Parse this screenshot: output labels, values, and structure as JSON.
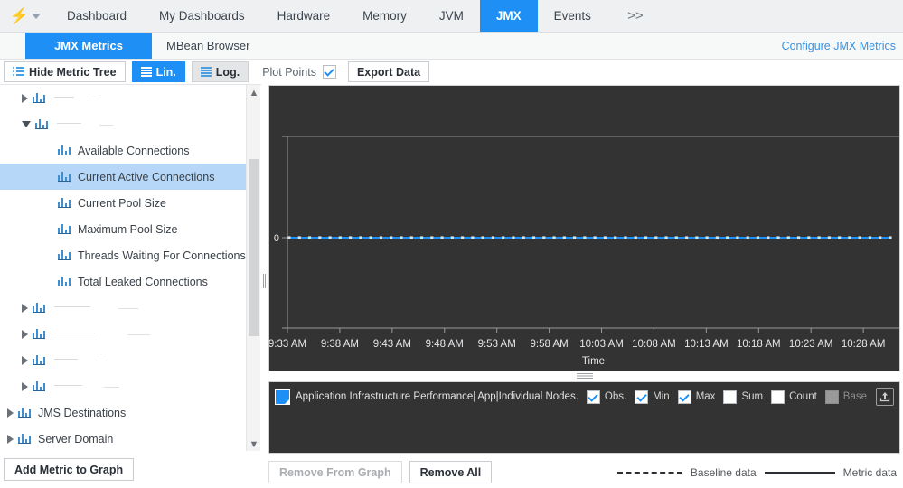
{
  "topnav": {
    "logo_icon": "bolt-icon",
    "caret_icon": "chevron-down-icon",
    "items": [
      {
        "label": "Dashboard",
        "active": false
      },
      {
        "label": "My Dashboards",
        "active": false
      },
      {
        "label": "Hardware",
        "active": false
      },
      {
        "label": "Memory",
        "active": false
      },
      {
        "label": "JVM",
        "active": false
      },
      {
        "label": "JMX",
        "active": true
      },
      {
        "label": "Events",
        "active": false
      }
    ],
    "more_label": ">>"
  },
  "subnav": {
    "tabs": [
      {
        "label": "JMX Metrics",
        "active": true
      },
      {
        "label": "MBean Browser",
        "active": false
      }
    ],
    "configure_link": "Configure JMX Metrics"
  },
  "toolbar": {
    "hide_tree_label": "Hide Metric Tree",
    "hide_tree_icon": "tree-list-icon",
    "lin_label": "Lin.",
    "lin_icon": "lines-icon",
    "log_label": "Log.",
    "log_icon": "lines-icon",
    "plot_points_label": "Plot Points",
    "plot_points_checked": true,
    "export_label": "Export Data"
  },
  "tree": {
    "items": [
      {
        "label": "",
        "redacted": true,
        "state": "collapsed",
        "depth": 1,
        "selected": false
      },
      {
        "label": "",
        "redacted": true,
        "state": "expanded",
        "depth": 1,
        "selected": false
      },
      {
        "label": "Available Connections",
        "redacted": false,
        "state": "leaf",
        "depth": 2,
        "selected": false
      },
      {
        "label": "Current Active Connections",
        "redacted": false,
        "state": "leaf",
        "depth": 2,
        "selected": true
      },
      {
        "label": "Current Pool Size",
        "redacted": false,
        "state": "leaf",
        "depth": 2,
        "selected": false
      },
      {
        "label": "Maximum Pool Size",
        "redacted": false,
        "state": "leaf",
        "depth": 2,
        "selected": false
      },
      {
        "label": "Threads Waiting For Connections",
        "redacted": false,
        "state": "leaf",
        "depth": 2,
        "selected": false
      },
      {
        "label": "Total Leaked Connections",
        "redacted": false,
        "state": "leaf",
        "depth": 2,
        "selected": false
      },
      {
        "label": "",
        "redacted": true,
        "state": "collapsed",
        "depth": 1,
        "selected": false
      },
      {
        "label": "",
        "redacted": true,
        "state": "collapsed",
        "depth": 1,
        "selected": false
      },
      {
        "label": "",
        "redacted": true,
        "state": "collapsed",
        "depth": 1,
        "selected": false
      },
      {
        "label": "",
        "redacted": true,
        "state": "collapsed",
        "depth": 1,
        "selected": false
      },
      {
        "label": "JMS Destinations",
        "redacted": false,
        "state": "collapsed",
        "depth": 0,
        "selected": false
      },
      {
        "label": "Server Domain",
        "redacted": false,
        "state": "collapsed",
        "depth": 0,
        "selected": false
      }
    ],
    "scroll_up_icon": "chevron-up-icon",
    "scroll_down_icon": "chevron-down-icon",
    "add_metric_label": "Add Metric to Graph"
  },
  "chart_data": {
    "type": "line",
    "title": "",
    "xlabel": "Time",
    "ylabel": "",
    "x": [
      "9:33 AM",
      "9:38 AM",
      "9:43 AM",
      "9:48 AM",
      "9:53 AM",
      "9:58 AM",
      "10:03 AM",
      "10:08 AM",
      "10:13 AM",
      "10:18 AM",
      "10:23 AM",
      "10:28 AM"
    ],
    "xtick_labels": [
      "9:33 AM",
      "9:38 AM",
      "9:43 AM",
      "9:48 AM",
      "9:53 AM",
      "9:58 AM",
      "10:03 AM",
      "10:08 AM",
      "10:13 AM",
      "10:18 AM",
      "10:23 AM",
      "10:28 AM"
    ],
    "ytick_labels": [
      "0"
    ],
    "ylim": [
      -1,
      1
    ],
    "grid": false,
    "legend_position": "below",
    "series": [
      {
        "name": "Application Infrastructure Performance|App|Individual Nodes...",
        "color": "#1e90f5",
        "marker": "square",
        "n_points": 60,
        "values": [
          0,
          0,
          0,
          0,
          0,
          0,
          0,
          0,
          0,
          0,
          0,
          0,
          0,
          0,
          0,
          0,
          0,
          0,
          0,
          0,
          0,
          0,
          0,
          0,
          0,
          0,
          0,
          0,
          0,
          0,
          0,
          0,
          0,
          0,
          0,
          0,
          0,
          0,
          0,
          0,
          0,
          0,
          0,
          0,
          0,
          0,
          0,
          0,
          0,
          0,
          0,
          0,
          0,
          0,
          0,
          0,
          0,
          0,
          0,
          0
        ]
      }
    ],
    "background": "#333333",
    "axis_color": "#9a9a9a"
  },
  "legend": {
    "series_name_prefix": "Application Infrastructure Performance|",
    "series_name_suffix": "App|Individual Nodes...",
    "swatch_color": "#1e90f5",
    "toggles": [
      {
        "label": "Obs.",
        "checked": true,
        "disabled": false
      },
      {
        "label": "Min",
        "checked": true,
        "disabled": false
      },
      {
        "label": "Max",
        "checked": true,
        "disabled": false
      },
      {
        "label": "Sum",
        "checked": false,
        "disabled": false
      },
      {
        "label": "Count",
        "checked": false,
        "disabled": false
      },
      {
        "label": "Base",
        "checked": false,
        "disabled": true
      }
    ],
    "upload_icon": "upload-icon"
  },
  "bottom": {
    "remove_from_graph_label": "Remove From Graph",
    "remove_from_graph_disabled": true,
    "remove_all_label": "Remove All",
    "baseline_key_label": "Baseline data",
    "metric_key_label": "Metric data"
  }
}
